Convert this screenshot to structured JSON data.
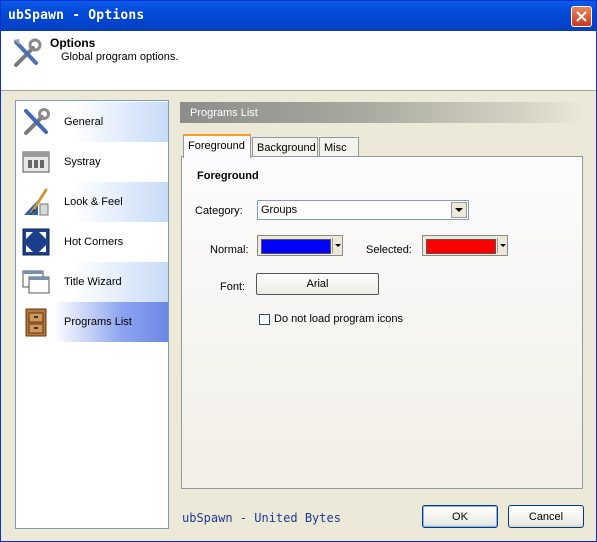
{
  "window": {
    "title": "ubSpawn - Options"
  },
  "header": {
    "title": "Options",
    "subtitle": "Global program options."
  },
  "sidebar": {
    "items": [
      {
        "label": "General",
        "icon": "tools-icon"
      },
      {
        "label": "Systray",
        "icon": "systray-icon"
      },
      {
        "label": "Look & Feel",
        "icon": "paintbrush-icon"
      },
      {
        "label": "Hot Corners",
        "icon": "hot-corners-icon"
      },
      {
        "label": "Title Wizard",
        "icon": "windows-icon"
      },
      {
        "label": "Programs List",
        "icon": "cabinet-icon",
        "selected": true
      }
    ]
  },
  "panel": {
    "title": "Programs List",
    "tabs": [
      {
        "label": "Foreground",
        "active": true
      },
      {
        "label": "Background"
      },
      {
        "label": "Misc"
      }
    ],
    "group_title": "Foreground",
    "category": {
      "label": "Category:",
      "value": "Groups"
    },
    "normal": {
      "label": "Normal:",
      "color": "#0000ff"
    },
    "selected": {
      "label": "Selected:",
      "color": "#ff0000"
    },
    "font": {
      "label": "Font:",
      "value": "Arial"
    },
    "no_icons": {
      "label": "Do not load program icons",
      "checked": false
    }
  },
  "footer": {
    "brand": "ubSpawn - United Bytes",
    "ok_label": "OK",
    "cancel_label": "Cancel"
  },
  "colors": {
    "title_bar": "#0248d8",
    "accent": "#6c88e4",
    "tab_highlight": "#f1a326"
  }
}
